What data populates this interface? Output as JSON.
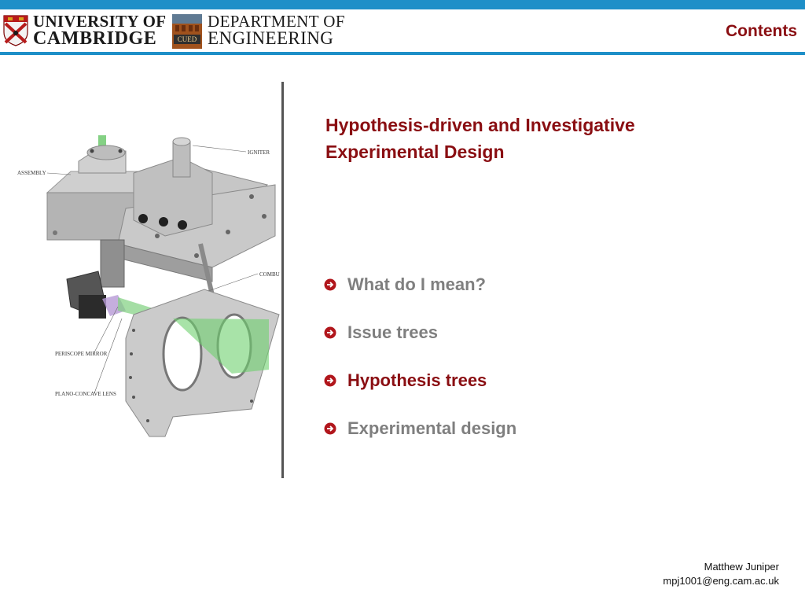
{
  "header": {
    "university_line1": "UNIVERSITY OF",
    "university_line2": "CAMBRIDGE",
    "department_line1": "DEPARTMENT OF",
    "department_line2": "ENGINEERING",
    "cued_badge": "CUED",
    "contents_link": "Contents"
  },
  "figure": {
    "labels": [
      "IGNITER",
      "ASSEMBLY",
      "COMBU",
      "PERISCOPE MIRROR",
      "PLANO-CONCAVE LENS"
    ]
  },
  "slide": {
    "title_line1": "Hypothesis-driven and Investigative",
    "title_line2": "Experimental Design",
    "bullets": [
      {
        "label": "What do I mean?",
        "active": false
      },
      {
        "label": "Issue trees",
        "active": false
      },
      {
        "label": "Hypothesis trees",
        "active": true
      },
      {
        "label": "Experimental design",
        "active": false
      }
    ]
  },
  "footer": {
    "author": "Matthew Juniper",
    "email": "mpj1001@eng.cam.ac.uk"
  },
  "colors": {
    "accent_blue": "#1e8fc8",
    "title_red": "#8a0e12",
    "inactive_grey": "#7f7f7f"
  }
}
